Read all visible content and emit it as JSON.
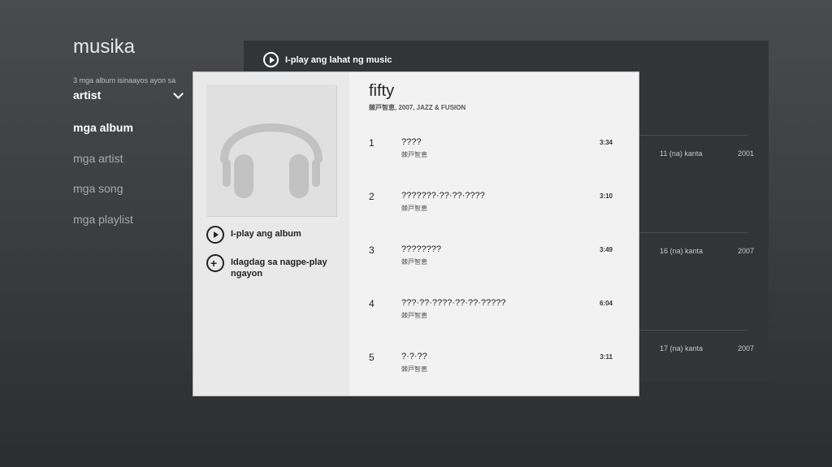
{
  "app": {
    "title": "musika"
  },
  "sort": {
    "caption": "3 mga album isinaayos ayon sa",
    "value": "artist"
  },
  "nav": {
    "items": [
      {
        "label": "mga album",
        "active": true
      },
      {
        "label": "mga artist"
      },
      {
        "label": "mga song"
      },
      {
        "label": "mga playlist"
      }
    ]
  },
  "background": {
    "play_all_label": "I-play ang lahat ng music",
    "albums": [
      {
        "count": "11 (na) kanta",
        "year": "2001"
      },
      {
        "count": "16 (na) kanta",
        "year": "2007"
      },
      {
        "count": "17 (na) kanta",
        "year": "2007"
      }
    ]
  },
  "dialog": {
    "album_title": "fifty",
    "album_meta": "棘戸智恵, 2007, JAZZ & FUSION",
    "actions": {
      "play_album": "I-play ang album",
      "add_now_playing": "Idagdag sa nagpe-play ngayon"
    },
    "tracks": [
      {
        "num": "1",
        "name": "????",
        "artist": "棘戸智恵",
        "duration": "3:34"
      },
      {
        "num": "2",
        "name": "???????·??·??·????",
        "artist": "棘戸智恵",
        "duration": "3:10"
      },
      {
        "num": "3",
        "name": "????????",
        "artist": "棘戸智恵",
        "duration": "3:49"
      },
      {
        "num": "4",
        "name": "???·??·????·??·??·?????",
        "artist": "棘戸智恵",
        "duration": "6:04"
      },
      {
        "num": "5",
        "name": "?·?·??",
        "artist": "棘戸智恵",
        "duration": "3:11"
      }
    ]
  },
  "icons": [
    "play-circle-icon",
    "add-to-now-playing-icon",
    "headphones-icon",
    "chevron-down-icon"
  ],
  "colors": {
    "background": "#3a3b3d",
    "dialog": "#f2f2f2",
    "left_column": "#e9e9e9"
  }
}
